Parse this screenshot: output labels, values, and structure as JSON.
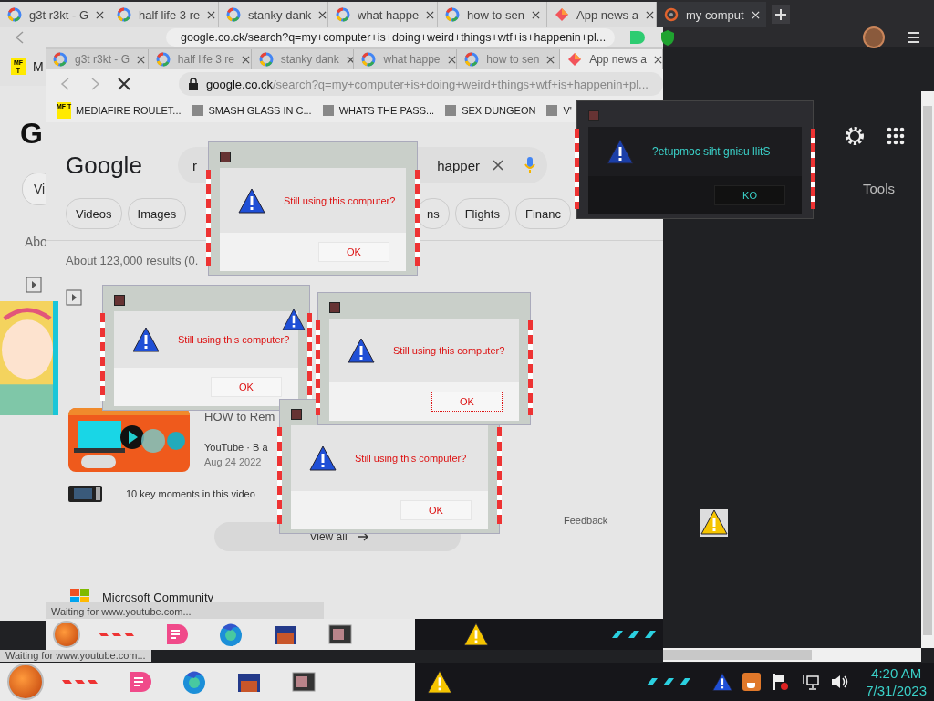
{
  "back_window": {
    "tabs": [
      {
        "title": "g3t r3kt - G",
        "kind": "google",
        "selected": false
      },
      {
        "title": "half life 3 re",
        "kind": "google",
        "selected": false
      },
      {
        "title": "stanky dank",
        "kind": "google",
        "selected": false
      },
      {
        "title": "what happe",
        "kind": "google",
        "selected": false
      },
      {
        "title": "how to sen",
        "kind": "google",
        "selected": false
      },
      {
        "title": "App news a",
        "kind": "app",
        "selected": false
      },
      {
        "title": "my comput",
        "kind": "ring",
        "selected": true
      }
    ],
    "address": "google.co.ck/search?q=my+computer+is+doing+weird+things+wtf+is+happenin+pl...",
    "bookmark": {
      "icon_text": "MF T",
      "label": "M"
    },
    "page": {
      "logo": "G",
      "chip": "Vi",
      "about": "Abo"
    }
  },
  "front_window": {
    "tabs": [
      {
        "title": "g3t r3kt - G",
        "kind": "google",
        "selected": false
      },
      {
        "title": "half life 3 re",
        "kind": "google",
        "selected": false
      },
      {
        "title": "stanky dank",
        "kind": "google",
        "selected": false
      },
      {
        "title": "what happe",
        "kind": "google",
        "selected": false
      },
      {
        "title": "how to sen",
        "kind": "google",
        "selected": false
      },
      {
        "title": "App news a",
        "kind": "app",
        "selected": true
      }
    ],
    "address_host": "google.co.ck",
    "address_path": "/search?q=my+computer+is+doing+weird+things+wtf+is+happenin+pl...",
    "bookmarks": [
      {
        "label": "MEDIAFIRE ROULET...",
        "icon_text": "MF T"
      },
      {
        "label": "SMASH GLASS IN C..."
      },
      {
        "label": "WHATS THE PASS..."
      },
      {
        "label": "SEX DUNGEON"
      },
      {
        "label": "V'"
      }
    ],
    "logo": "Google",
    "search_left": "r",
    "search_right": "happer",
    "chips": [
      {
        "label": "Videos"
      },
      {
        "label": "Images"
      },
      {
        "label": "ns"
      },
      {
        "label": "Flights"
      },
      {
        "label": "Financ"
      }
    ],
    "result_count": "About 123,000 results (0.",
    "video": {
      "title": "HOW to Rem",
      "source": "YouTube · B a",
      "date": "Aug 24 2022",
      "key_moments": "10 key moments in this video"
    },
    "view_all": "View all",
    "feedback": "Feedback",
    "community": "Microsoft Community",
    "status": "Waiting for www.youtube.com..."
  },
  "dialogs": [
    {
      "kind": "normal",
      "message": "Still using this computer?",
      "button": "OK",
      "focused": false
    },
    {
      "kind": "normal",
      "message": "Still using this computer?",
      "button": "OK",
      "focused": false
    },
    {
      "kind": "normal",
      "message": "Still using this computer?",
      "button": "OK",
      "focused": true
    },
    {
      "kind": "normal",
      "message": "Still using this computer?",
      "button": "OK",
      "focused": false
    },
    {
      "kind": "mirrored",
      "message": "?etupmoc siht gnisu llitS",
      "button": "KO",
      "focused": false
    }
  ],
  "right_panel": {
    "tools": "Tools"
  },
  "lower_status": "Waiting for www.youtube.com...",
  "taskbar": {
    "time": "4:20 AM",
    "date": "7/31/2023"
  }
}
